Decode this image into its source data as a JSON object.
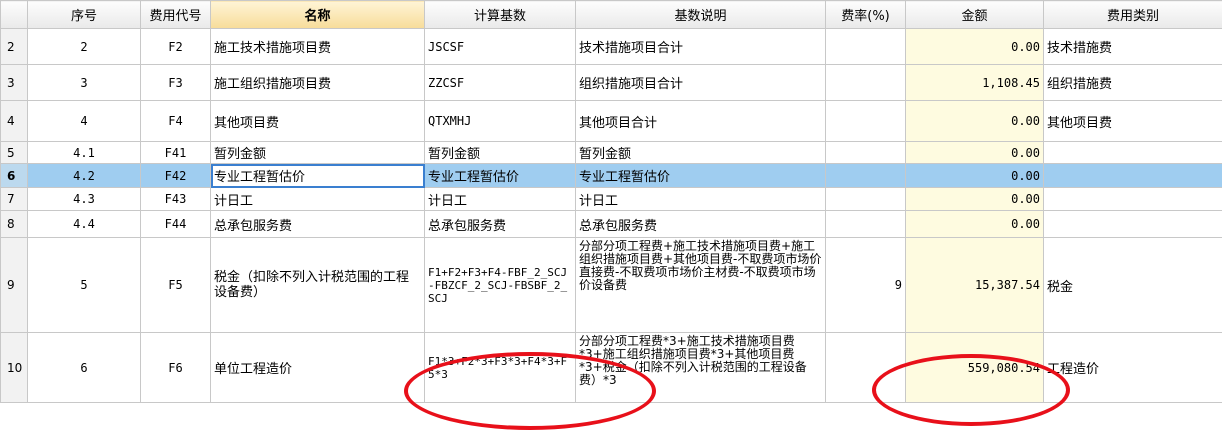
{
  "columns": [
    "",
    "序号",
    "费用代号",
    "名称",
    "计算基数",
    "基数说明",
    "费率(%)",
    "金额",
    "费用类别"
  ],
  "rows": [
    {
      "rn": "2",
      "seq": "2",
      "code": "F2",
      "name": "施工技术措施项目费",
      "base": "JSCSF",
      "desc": "技术措施项目合计",
      "rate": "",
      "amount": "0.00",
      "category": "技术措施费"
    },
    {
      "rn": "3",
      "seq": "3",
      "code": "F3",
      "name": "施工组织措施项目费",
      "base": "ZZCSF",
      "desc": "组织措施项目合计",
      "rate": "",
      "amount": "1,108.45",
      "category": "组织措施费"
    },
    {
      "rn": "4",
      "seq": "4",
      "code": "F4",
      "name": "其他项目费",
      "base": "QTXMHJ",
      "desc": "其他项目合计",
      "rate": "",
      "amount": "0.00",
      "category": "其他项目费"
    },
    {
      "rn": "5",
      "seq": "4.1",
      "code": "F41",
      "name": "暂列金额",
      "base": "暂列金额",
      "desc": "暂列金额",
      "rate": "",
      "amount": "0.00",
      "category": ""
    },
    {
      "rn": "6",
      "seq": "4.2",
      "code": "F42",
      "name": "专业工程暂估价",
      "base": "专业工程暂估价",
      "desc": "专业工程暂估价",
      "rate": "",
      "amount": "0.00",
      "category": ""
    },
    {
      "rn": "7",
      "seq": "4.3",
      "code": "F43",
      "name": "计日工",
      "base": "计日工",
      "desc": "计日工",
      "rate": "",
      "amount": "0.00",
      "category": ""
    },
    {
      "rn": "8",
      "seq": "4.4",
      "code": "F44",
      "name": "总承包服务费",
      "base": "总承包服务费",
      "desc": "总承包服务费",
      "rate": "",
      "amount": "0.00",
      "category": ""
    },
    {
      "rn": "9",
      "seq": "5",
      "code": "F5",
      "name": "税金（扣除不列入计税范围的工程设备费）",
      "base": "F1+F2+F3+F4-FBF_2_SCJ-FBZCF_2_SCJ-FBSBF_2_SCJ",
      "desc": "分部分项工程费+施工技术措施项目费+施工组织措施项目费+其他项目费-不取费项市场价直接费-不取费项市场价主材费-不取费项市场价设备费",
      "rate": "9",
      "amount": "15,387.54",
      "category": "税金"
    },
    {
      "rn": "10",
      "seq": "6",
      "code": "F6",
      "name": "单位工程造价",
      "base": "F1*3+F2*3+F3*3+F4*3+F5*3",
      "desc": "分部分项工程费*3+施工技术措施项目费*3+施工组织措施项目费*3+其他项目费*3+税金（扣除不列入计税范围的工程设备费）*3",
      "rate": "",
      "amount": "559,080.54",
      "category": "工程造价"
    }
  ],
  "selected_row": 4,
  "annotation_color": "#e8101a"
}
